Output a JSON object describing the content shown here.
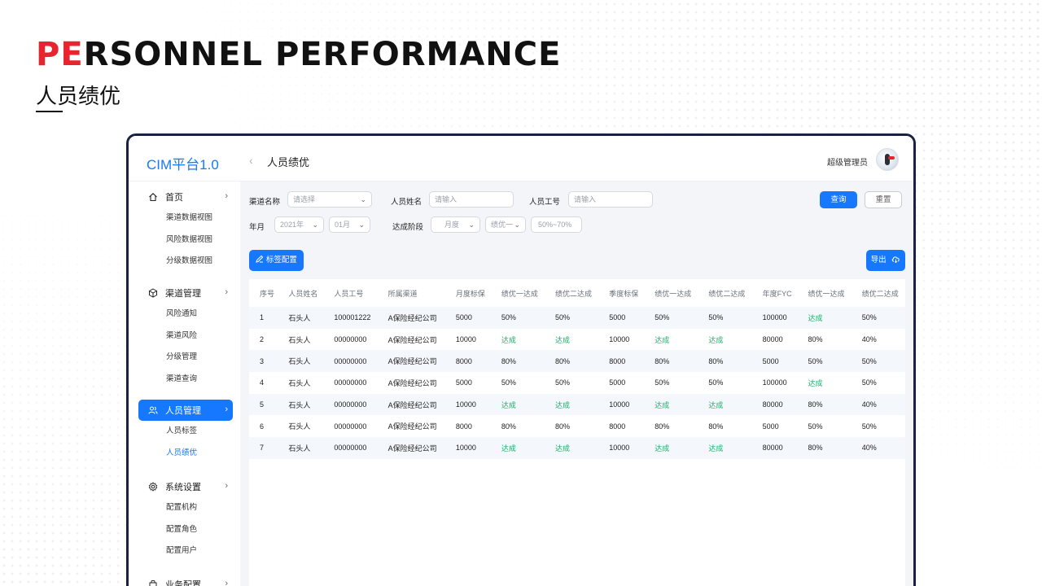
{
  "hero": {
    "title_accent": "PE",
    "title_rest": "RSONNEL PERFORMANCE",
    "subtitle": "人员绩优"
  },
  "app": {
    "logo": "CIM平台1.0",
    "page_title": "人员绩优",
    "admin_name": "超级管理员"
  },
  "sidebar": {
    "groups": [
      {
        "label": "首页",
        "icon": "home-icon",
        "items": [
          "渠道数据视图",
          "风险数据视图",
          "分级数据视图"
        ]
      },
      {
        "label": "渠道管理",
        "icon": "cube-icon",
        "items": [
          "风险通知",
          "渠道风险",
          "分级管理",
          "渠道查询"
        ]
      },
      {
        "label": "人员管理",
        "icon": "users-icon",
        "active": true,
        "items": [
          "人员标签",
          "人员绩优"
        ],
        "active_item": "人员绩优"
      },
      {
        "label": "系统设置",
        "icon": "gear-icon",
        "items": [
          "配置机构",
          "配置角色",
          "配置用户"
        ]
      },
      {
        "label": "业务配置",
        "icon": "bag-icon",
        "items": []
      }
    ]
  },
  "filters": {
    "channel_label": "渠道名称",
    "channel_placeholder": "请选择",
    "name_label": "人员姓名",
    "name_placeholder": "请输入",
    "id_label": "人员工号",
    "id_placeholder": "请输入",
    "month_label": "年月",
    "year_value": "2021年",
    "month_value": "01月",
    "stage_label": "达成阶段",
    "stage_period": "月度",
    "stage_type": "绩优一",
    "stage_range": "50%~70%",
    "query_button": "查询",
    "reset_button": "重置"
  },
  "toolbar": {
    "tag_config_button": "标签配置",
    "export_button": "导出"
  },
  "table": {
    "columns": [
      "序号",
      "人员姓名",
      "人员工号",
      "所属渠道",
      "月度标保",
      "绩优一达成",
      "绩优二达成",
      "季度标保",
      "绩优一达成",
      "绩优二达成",
      "年度FYC",
      "绩优一达成",
      "绩优二达成"
    ],
    "rows": [
      [
        "1",
        "石头人",
        "100001222",
        "A保险经纪公司",
        "5000",
        "50%",
        "50%",
        "5000",
        "50%",
        "50%",
        "100000",
        "达成",
        "50%"
      ],
      [
        "2",
        "石头人",
        "00000000",
        "A保险经纪公司",
        "10000",
        "达成",
        "达成",
        "10000",
        "达成",
        "达成",
        "80000",
        "80%",
        "40%"
      ],
      [
        "3",
        "石头人",
        "00000000",
        "A保险经纪公司",
        "8000",
        "80%",
        "80%",
        "8000",
        "80%",
        "80%",
        "5000",
        "50%",
        "50%"
      ],
      [
        "4",
        "石头人",
        "00000000",
        "A保险经纪公司",
        "5000",
        "50%",
        "50%",
        "5000",
        "50%",
        "50%",
        "100000",
        "达成",
        "50%"
      ],
      [
        "5",
        "石头人",
        "00000000",
        "A保险经纪公司",
        "10000",
        "达成",
        "达成",
        "10000",
        "达成",
        "达成",
        "80000",
        "80%",
        "40%"
      ],
      [
        "6",
        "石头人",
        "00000000",
        "A保险经纪公司",
        "8000",
        "80%",
        "80%",
        "8000",
        "80%",
        "80%",
        "5000",
        "50%",
        "50%"
      ],
      [
        "7",
        "石头人",
        "00000000",
        "A保险经纪公司",
        "10000",
        "达成",
        "达成",
        "10000",
        "达成",
        "达成",
        "80000",
        "80%",
        "40%"
      ]
    ],
    "achieved_text": "达成",
    "achieved_color": "#17b26a"
  },
  "colors": {
    "accent": "#e8242e",
    "primary": "#1677ff",
    "frame": "#1b2240"
  }
}
